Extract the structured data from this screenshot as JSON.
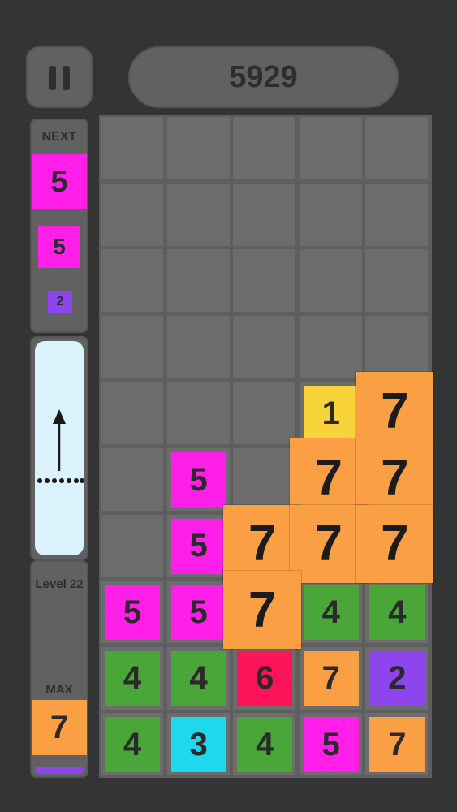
{
  "hud": {
    "score": "5929",
    "pause_icon": "pause-icon"
  },
  "next": {
    "label": "NEXT",
    "queue": [
      {
        "value": "5",
        "color": "#ff1fe8"
      },
      {
        "value": "5",
        "color": "#ff1fe8"
      },
      {
        "value": "2",
        "color": "#8f45ee"
      }
    ]
  },
  "launcher": {
    "arrow_icon": "up-arrow-icon"
  },
  "level": {
    "label": "Level 22",
    "max_label": "MAX",
    "max_value": "7",
    "max_color": "#fb9f45",
    "progress_color": "#8f45ee"
  },
  "board": {
    "rows": 10,
    "cols": 5,
    "tiles": [
      {
        "row": 6,
        "col": 2,
        "value": "5",
        "color": "#ff1fe8"
      },
      {
        "row": 7,
        "col": 2,
        "value": "5",
        "color": "#ff1fe8"
      },
      {
        "row": 8,
        "col": 1,
        "value": "5",
        "color": "#ff1fe8"
      },
      {
        "row": 8,
        "col": 2,
        "value": "5",
        "color": "#ff1fe8"
      },
      {
        "row": 8,
        "col": 4,
        "value": "4",
        "color": "#4ba63a"
      },
      {
        "row": 8,
        "col": 5,
        "value": "4",
        "color": "#4ba63a"
      },
      {
        "row": 9,
        "col": 1,
        "value": "4",
        "color": "#4ba63a"
      },
      {
        "row": 9,
        "col": 2,
        "value": "4",
        "color": "#4ba63a"
      },
      {
        "row": 9,
        "col": 3,
        "value": "6",
        "color": "#fd1458"
      },
      {
        "row": 9,
        "col": 4,
        "value": "7",
        "color": "#fb9f45"
      },
      {
        "row": 9,
        "col": 5,
        "value": "2",
        "color": "#8f45ee"
      },
      {
        "row": 10,
        "col": 1,
        "value": "4",
        "color": "#4ba63a"
      },
      {
        "row": 10,
        "col": 2,
        "value": "3",
        "color": "#1ed9ee"
      },
      {
        "row": 10,
        "col": 3,
        "value": "4",
        "color": "#4ba63a"
      },
      {
        "row": 10,
        "col": 4,
        "value": "5",
        "color": "#ff1fe8"
      },
      {
        "row": 10,
        "col": 5,
        "value": "7",
        "color": "#fb9f45"
      },
      {
        "row": 5,
        "col": 4,
        "value": "1",
        "color": "#f8d43a"
      }
    ],
    "merged_tiles": [
      {
        "row": 5,
        "col": 5,
        "value": "7",
        "color": "#fb9f45"
      },
      {
        "row": 6,
        "col": 4,
        "value": "7",
        "color": "#fb9f45"
      },
      {
        "row": 6,
        "col": 5,
        "value": "7",
        "color": "#fb9f45"
      },
      {
        "row": 7,
        "col": 3,
        "value": "7",
        "color": "#fb9f45"
      },
      {
        "row": 7,
        "col": 4,
        "value": "7",
        "color": "#fb9f45"
      },
      {
        "row": 7,
        "col": 5,
        "value": "7",
        "color": "#fb9f45"
      },
      {
        "row": 8,
        "col": 3,
        "value": "7",
        "color": "#fb9f45"
      }
    ]
  }
}
